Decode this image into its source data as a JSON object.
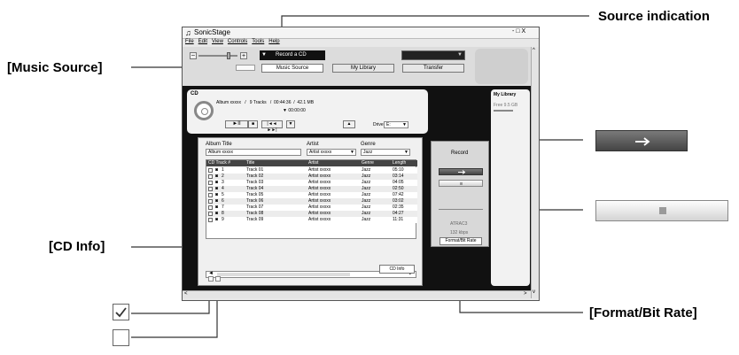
{
  "callouts": {
    "source_indication": "Source indication",
    "music_source": "[Music Source]",
    "cd_info": "[CD Info]",
    "format_bit_rate": "[Format/Bit Rate]"
  },
  "window": {
    "title": "SonicStage",
    "controls": "- □ X",
    "menu": [
      "File",
      "Edit",
      "View",
      "Controls",
      "Tools",
      "Help"
    ]
  },
  "toolbar": {
    "source_label": "Record a CD",
    "tabs": [
      "Music Source",
      "My Library",
      "Transfer"
    ]
  },
  "cd_panel": {
    "header": "CD",
    "album_line": "Album xxxxx   /   9 Tracks   /  00:44:36  /  42.1 MB",
    "time": "▼  00:00:00",
    "drive_label": "Drive",
    "drive_value": "E:"
  },
  "fields": {
    "album_title_label": "Album Title",
    "album_title_value": "Album xxxxx",
    "artist_label": "Artist",
    "artist_value": "Artist xxxxx",
    "genre_label": "Genre",
    "genre_value": "Jazz"
  },
  "table": {
    "headers": [
      "CD Track #",
      "Title",
      "Artist",
      "Genre",
      "Length"
    ],
    "rows": [
      {
        "n": "1",
        "title": "Track 01",
        "artist": "Artist xxxxx",
        "genre": "Jazz",
        "length": "05:10"
      },
      {
        "n": "2",
        "title": "Track 02",
        "artist": "Artist xxxxx",
        "genre": "Jazz",
        "length": "03:14"
      },
      {
        "n": "3",
        "title": "Track 03",
        "artist": "Artist xxxxx",
        "genre": "Jazz",
        "length": "04:05"
      },
      {
        "n": "4",
        "title": "Track 04",
        "artist": "Artist xxxxx",
        "genre": "Jazz",
        "length": "02:50"
      },
      {
        "n": "5",
        "title": "Track 05",
        "artist": "Artist xxxxx",
        "genre": "Jazz",
        "length": "07:42"
      },
      {
        "n": "6",
        "title": "Track 06",
        "artist": "Artist xxxxx",
        "genre": "Jazz",
        "length": "03:02"
      },
      {
        "n": "7",
        "title": "Track 07",
        "artist": "Artist xxxxx",
        "genre": "Jazz",
        "length": "02:35"
      },
      {
        "n": "8",
        "title": "Track 08",
        "artist": "Artist xxxxx",
        "genre": "Jazz",
        "length": "04:27"
      },
      {
        "n": "9",
        "title": "Track 09",
        "artist": "Artist xxxxx",
        "genre": "Jazz",
        "length": "11:31"
      }
    ]
  },
  "buttons": {
    "cd_info": "CD Info"
  },
  "record_panel": {
    "title": "Record",
    "format": "ATRAC3",
    "bitrate": "132 kbps",
    "format_button": "Format/Bit Rate"
  },
  "library_panel": {
    "title": "My Library",
    "free": "Free 9.5 GB"
  },
  "colors": {
    "record_button": "#5a5a5a",
    "accent": "#111111"
  }
}
